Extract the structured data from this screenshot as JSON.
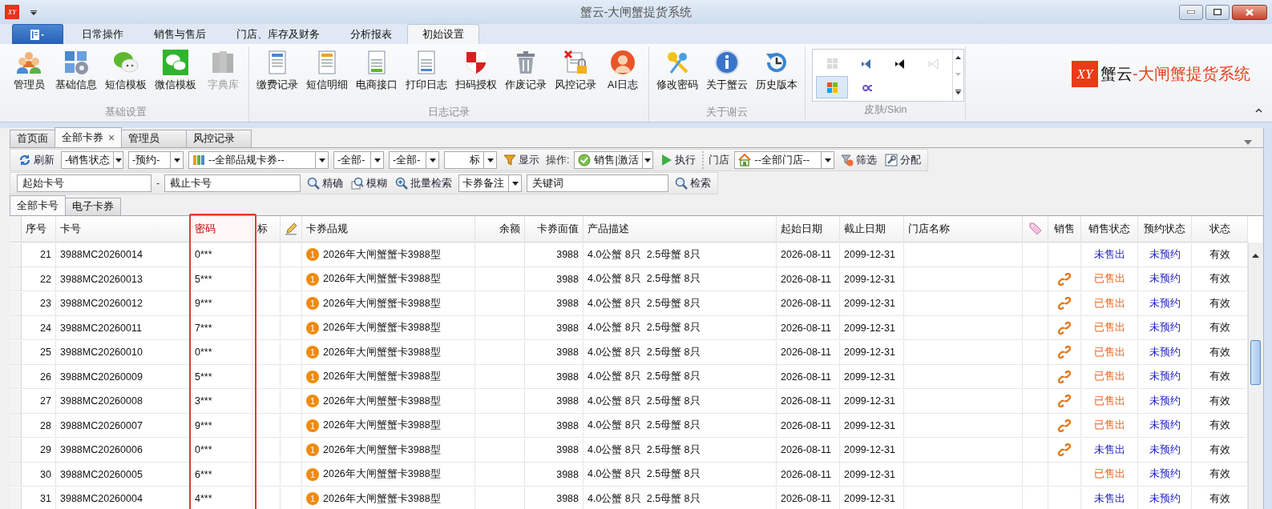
{
  "window": {
    "icon_mark": "XY",
    "title": "蟹云-大闸蟹提货系统"
  },
  "ribbon_tabs": [
    {
      "label": "日常操作",
      "selected": false
    },
    {
      "label": "销售与售后",
      "selected": false
    },
    {
      "label": "门店、库存及财务",
      "selected": false
    },
    {
      "label": "分析报表",
      "selected": false
    },
    {
      "label": "初始设置",
      "selected": true
    }
  ],
  "ribbon_groups": [
    {
      "label": "基础设置",
      "buttons": [
        {
          "label": "管理员",
          "disabled": false
        },
        {
          "label": "基础信息",
          "disabled": false
        },
        {
          "label": "短信模板",
          "disabled": false
        },
        {
          "label": "微信模板",
          "disabled": false
        },
        {
          "label": "字典库",
          "disabled": true
        }
      ]
    },
    {
      "label": "日志记录",
      "buttons": [
        {
          "label": "缴费记录",
          "disabled": false
        },
        {
          "label": "短信明细",
          "disabled": false
        },
        {
          "label": "电商接口",
          "disabled": false
        },
        {
          "label": "打印日志",
          "disabled": false
        },
        {
          "label": "扫码授权",
          "disabled": false
        },
        {
          "label": "作废记录",
          "disabled": false
        },
        {
          "label": "风控记录",
          "disabled": false
        },
        {
          "label": "AI日志",
          "disabled": false
        }
      ]
    },
    {
      "label": "关于谢云",
      "buttons": [
        {
          "label": "修改密码",
          "disabled": false
        },
        {
          "label": "关于蟹云",
          "disabled": false
        },
        {
          "label": "历史版本",
          "disabled": false
        }
      ]
    }
  ],
  "skin_gallery": {
    "label": "皮肤/Skin",
    "skins": [
      {
        "selected": false,
        "disabled": true
      },
      {
        "selected": false,
        "disabled": false
      },
      {
        "selected": false,
        "disabled": false
      },
      {
        "selected": false,
        "disabled": true
      },
      {
        "selected": true,
        "disabled": false
      },
      {
        "selected": false,
        "disabled": false
      }
    ]
  },
  "brand": {
    "mark": "XY",
    "name": "蟹云",
    "tagline": "-大闸蟹提货系统"
  },
  "doc_tabs": [
    {
      "label": "首页面",
      "selected": false
    },
    {
      "label": "全部卡券",
      "selected": true,
      "close": "×"
    },
    {
      "label": "管理员",
      "selected": false
    },
    {
      "label": "风控记录",
      "selected": false
    }
  ],
  "toolbars": [
    {
      "items": [
        {
          "kind": "button",
          "label": "刷新"
        },
        {
          "kind": "dropdown",
          "value": "-销售状态"
        },
        {
          "kind": "dropdown",
          "value": "-预约-"
        },
        {
          "kind": "dropdown",
          "value": "--全部品规卡券--"
        },
        {
          "kind": "dropdown",
          "value": "-全部-"
        },
        {
          "kind": "dropdown",
          "value": "-全部-"
        },
        {
          "kind": "dropdown",
          "value": "标"
        },
        {
          "kind": "button",
          "label": "显示"
        },
        {
          "kind": "label",
          "label": "操作:"
        },
        {
          "kind": "dropdown",
          "value": "销售|激活"
        },
        {
          "kind": "button",
          "label": "执行"
        },
        {
          "kind": "separator"
        },
        {
          "kind": "label",
          "label": "门店"
        },
        {
          "kind": "dropdown",
          "value": "--全部门店--"
        },
        {
          "kind": "button",
          "label": "筛选"
        },
        {
          "kind": "button",
          "label": "分配"
        }
      ]
    },
    {
      "items": [
        {
          "kind": "input",
          "value": "起始卡号"
        },
        {
          "kind": "label",
          "label": "-"
        },
        {
          "kind": "input",
          "value": "截止卡号"
        },
        {
          "kind": "button",
          "label": "精确"
        },
        {
          "kind": "button",
          "label": "模糊"
        },
        {
          "kind": "button",
          "label": "批量检索"
        },
        {
          "kind": "dropdown",
          "value": "卡券备注"
        },
        {
          "kind": "input",
          "value": "关键词"
        },
        {
          "kind": "button",
          "label": "检索"
        }
      ]
    }
  ],
  "sub_tabs": [
    {
      "label": "全部卡号",
      "selected": true
    },
    {
      "label": "电子卡券",
      "selected": false
    }
  ],
  "table": {
    "columns": [
      {
        "kind": "text",
        "label": "序号",
        "highlighted": false
      },
      {
        "kind": "text",
        "label": "卡号",
        "highlighted": false
      },
      {
        "kind": "text",
        "label": "密码",
        "highlighted": true
      },
      {
        "kind": "text",
        "label": "标",
        "highlighted": false
      },
      {
        "kind": "icon",
        "highlighted": false
      },
      {
        "kind": "text",
        "label": "卡券品规",
        "highlighted": false
      },
      {
        "kind": "text",
        "label": "余额",
        "highlighted": false
      },
      {
        "kind": "text",
        "label": "卡券面值",
        "highlighted": false
      },
      {
        "kind": "text",
        "label": "产品描述",
        "highlighted": false
      },
      {
        "kind": "text",
        "label": "起始日期",
        "highlighted": false
      },
      {
        "kind": "text",
        "label": "截止日期",
        "highlighted": false
      },
      {
        "kind": "text",
        "label": "门店名称",
        "highlighted": false
      },
      {
        "kind": "icon",
        "highlighted": false
      },
      {
        "kind": "text",
        "label": "销售",
        "highlighted": false
      },
      {
        "kind": "text",
        "label": "销售状态",
        "highlighted": false
      },
      {
        "kind": "text",
        "label": "预约状态",
        "highlighted": false
      },
      {
        "kind": "text",
        "label": "状态",
        "highlighted": false
      }
    ],
    "rows": [
      {
        "no": "21",
        "card": "3988MC20260014",
        "password": "0***",
        "grade_badge": "1",
        "grade": "2026年大闸蟹蟹卡3988型",
        "face_value": "3988",
        "description": "4.0公蟹 8只  2.5母蟹 8只",
        "start": "2026-08-11",
        "end": "2099-12-31",
        "linked": false,
        "sale_status": "未售出",
        "sold": false,
        "reserve_status": "未预约",
        "status": "有效"
      },
      {
        "no": "22",
        "card": "3988MC20260013",
        "password": "5***",
        "grade_badge": "1",
        "grade": "2026年大闸蟹蟹卡3988型",
        "face_value": "3988",
        "description": "4.0公蟹 8只  2.5母蟹 8只",
        "start": "2026-08-11",
        "end": "2099-12-31",
        "linked": true,
        "sale_status": "已售出",
        "sold": true,
        "reserve_status": "未预约",
        "status": "有效"
      },
      {
        "no": "23",
        "card": "3988MC20260012",
        "password": "9***",
        "grade_badge": "1",
        "grade": "2026年大闸蟹蟹卡3988型",
        "face_value": "3988",
        "description": "4.0公蟹 8只  2.5母蟹 8只",
        "start": "2026-08-11",
        "end": "2099-12-31",
        "linked": true,
        "sale_status": "已售出",
        "sold": true,
        "reserve_status": "未预约",
        "status": "有效"
      },
      {
        "no": "24",
        "card": "3988MC20260011",
        "password": "7***",
        "grade_badge": "1",
        "grade": "2026年大闸蟹蟹卡3988型",
        "face_value": "3988",
        "description": "4.0公蟹 8只  2.5母蟹 8只",
        "start": "2026-08-11",
        "end": "2099-12-31",
        "linked": true,
        "sale_status": "已售出",
        "sold": true,
        "reserve_status": "未预约",
        "status": "有效"
      },
      {
        "no": "25",
        "card": "3988MC20260010",
        "password": "0***",
        "grade_badge": "1",
        "grade": "2026年大闸蟹蟹卡3988型",
        "face_value": "3988",
        "description": "4.0公蟹 8只  2.5母蟹 8只",
        "start": "2026-08-11",
        "end": "2099-12-31",
        "linked": true,
        "sale_status": "已售出",
        "sold": true,
        "reserve_status": "未预约",
        "status": "有效"
      },
      {
        "no": "26",
        "card": "3988MC20260009",
        "password": "5***",
        "grade_badge": "1",
        "grade": "2026年大闸蟹蟹卡3988型",
        "face_value": "3988",
        "description": "4.0公蟹 8只  2.5母蟹 8只",
        "start": "2026-08-11",
        "end": "2099-12-31",
        "linked": true,
        "sale_status": "已售出",
        "sold": true,
        "reserve_status": "未预约",
        "status": "有效"
      },
      {
        "no": "27",
        "card": "3988MC20260008",
        "password": "3***",
        "grade_badge": "1",
        "grade": "2026年大闸蟹蟹卡3988型",
        "face_value": "3988",
        "description": "4.0公蟹 8只  2.5母蟹 8只",
        "start": "2026-08-11",
        "end": "2099-12-31",
        "linked": true,
        "sale_status": "已售出",
        "sold": true,
        "reserve_status": "未预约",
        "status": "有效"
      },
      {
        "no": "28",
        "card": "3988MC20260007",
        "password": "9***",
        "grade_badge": "1",
        "grade": "2026年大闸蟹蟹卡3988型",
        "face_value": "3988",
        "description": "4.0公蟹 8只  2.5母蟹 8只",
        "start": "2026-08-11",
        "end": "2099-12-31",
        "linked": true,
        "sale_status": "已售出",
        "sold": true,
        "reserve_status": "未预约",
        "status": "有效"
      },
      {
        "no": "29",
        "card": "3988MC20260006",
        "password": "0***",
        "grade_badge": "1",
        "grade": "2026年大闸蟹蟹卡3988型",
        "face_value": "3988",
        "description": "4.0公蟹 8只  2.5母蟹 8只",
        "start": "2026-08-11",
        "end": "2099-12-31",
        "linked": true,
        "sale_status": "未售出",
        "sold": false,
        "reserve_status": "未预约",
        "status": "有效"
      },
      {
        "no": "30",
        "card": "3988MC20260005",
        "password": "6***",
        "grade_badge": "1",
        "grade": "2026年大闸蟹蟹卡3988型",
        "face_value": "3988",
        "description": "4.0公蟹 8只  2.5母蟹 8只",
        "start": "2026-08-11",
        "end": "2099-12-31",
        "linked": false,
        "sale_status": "已售出",
        "sold": true,
        "reserve_status": "未预约",
        "status": "有效"
      },
      {
        "no": "31",
        "card": "3988MC20260004",
        "password": "4***",
        "grade_badge": "1",
        "grade": "2026年大闸蟹蟹卡3988型",
        "face_value": "3988",
        "description": "4.0公蟹 8只  2.5母蟹 8只",
        "start": "2026-08-11",
        "end": "2099-12-31",
        "linked": false,
        "sale_status": "未售出",
        "sold": false,
        "reserve_status": "未预约",
        "status": "有效"
      }
    ]
  }
}
